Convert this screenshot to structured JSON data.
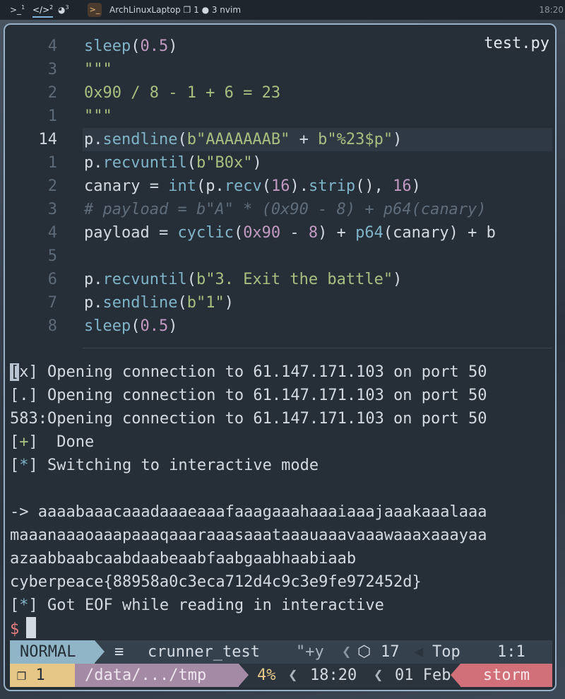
{
  "topbar": {
    "workspaces": [
      {
        "icon": "terminal-icon",
        "glyph": ">_",
        "num": "1"
      },
      {
        "icon": "code-icon",
        "glyph": "</>",
        "num": "2"
      },
      {
        "icon": "circle-half-icon",
        "glyph": "◕",
        "num": "3"
      }
    ],
    "window_title": "ArchLinuxLaptop ❐ 1 ● 3 nvim",
    "clock": "18:20"
  },
  "editor": {
    "filename": "test.py",
    "line_numbers": [
      "4",
      "3",
      "2",
      "1",
      "14",
      "1",
      "2",
      "3",
      "4",
      "5",
      "6",
      "7",
      "8"
    ]
  },
  "terminal": {
    "lines": [
      {
        "bracket": "[x]",
        "text": " Opening connection to 61.147.171.103 on port 50"
      },
      {
        "bracket": "[.]",
        "text": " Opening connection to 61.147.171.103 on port 50"
      },
      {
        "bracket": "583:",
        "text": "Opening connection to 61.147.171.103 on port 50"
      },
      {
        "bracket": "[+]",
        "text": "  Done"
      },
      {
        "bracket": "[*]",
        "text": " Switching to interactive mode"
      },
      {
        "bracket": "",
        "text": ""
      },
      {
        "bracket": "",
        "text": "-> aaaabaaacaaadaaaeaaafaaagaaahaaaiaaajaaakaaalaaa"
      },
      {
        "bracket": "",
        "text": "maaanaaaoaaapaaaqaaaraaasaaataaauaaavaaawaaaxaaayaa"
      },
      {
        "bracket": "",
        "text": "azaabbaabcaabdaabeaabfaabgaabhaabiaab"
      },
      {
        "bracket": "",
        "text": "cyberpeace{88958a0c3eca712d4c9c3e9fe972452d}"
      },
      {
        "bracket": "[*]",
        "text": " Got EOF while reading in interactive"
      }
    ],
    "prompt": "$"
  },
  "statusline": {
    "mode": "NORMAL",
    "buffer_icon": "≡",
    "buffer_name": "crunner_test",
    "register": "\"+y",
    "lsp_icon": "⬡",
    "lsp_count": "17",
    "position_word": "Top",
    "cursor_pos": "1:1",
    "tab_icon": "❐",
    "tab_num": "1",
    "path": "/data/.../tmp",
    "percent": "4%",
    "time": "18:20",
    "date": "01 Feb",
    "host": "storm"
  }
}
